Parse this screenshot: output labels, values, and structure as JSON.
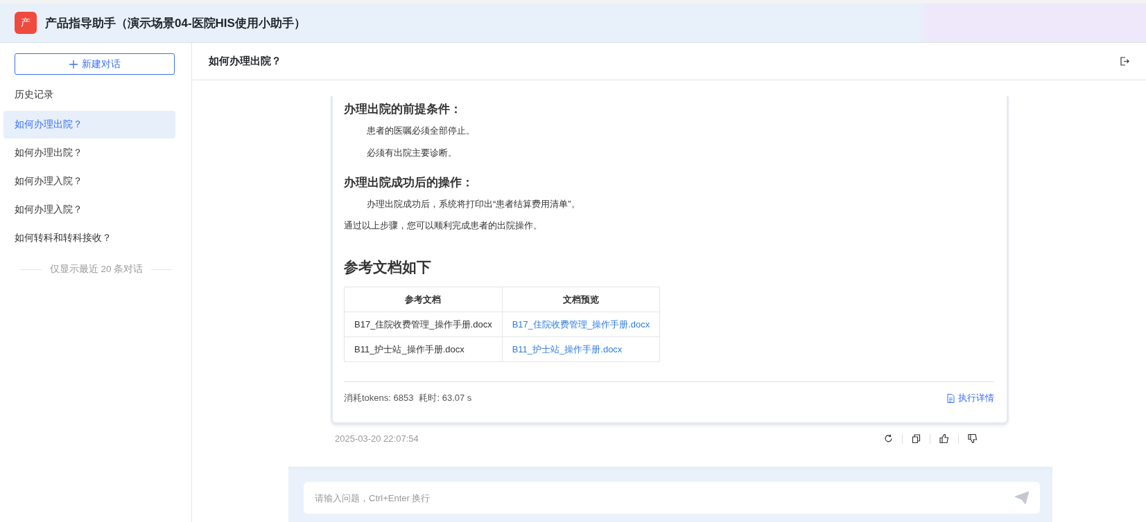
{
  "app": {
    "logo_text": "产",
    "title": "产品指导助手（演示场景04-医院HIS使用小助手）"
  },
  "sidebar": {
    "new_chat_button": "新建对话",
    "history_label": "历史记录",
    "items": [
      {
        "label": "如何办理出院？",
        "selected": true
      },
      {
        "label": "如何办理出院？",
        "selected": false
      },
      {
        "label": "如何办理入院？",
        "selected": false
      },
      {
        "label": "如何办理入院？",
        "selected": false
      },
      {
        "label": "如何转科和转科接收？",
        "selected": false
      }
    ],
    "footer_note": "仅显示最近 20 条对话"
  },
  "conversation": {
    "title": "如何办理出院？",
    "message": {
      "blocks": [
        {
          "kind": "heading",
          "text": "办理出院的前提条件："
        },
        {
          "kind": "indented",
          "text": "患者的医嘱必须全部停止。"
        },
        {
          "kind": "indented",
          "text": "必须有出院主要诊断。"
        },
        {
          "kind": "heading",
          "text": "办理出院成功后的操作："
        },
        {
          "kind": "indented",
          "text": "办理出院成功后，系统将打印出“患者结算费用清单”。"
        },
        {
          "kind": "paragraph",
          "text": "通过以上步骤，您可以顺利完成患者的出院操作。"
        },
        {
          "kind": "section_title",
          "text": "参考文档如下"
        }
      ],
      "table": {
        "columns": [
          "参考文档",
          "文档预览"
        ],
        "rows": [
          [
            "B17_住院收费管理_操作手册.docx",
            "B17_住院收费管理_操作手册.docx"
          ],
          [
            "B11_护士站_操作手册.docx",
            "B11_护士站_操作手册.docx"
          ]
        ]
      },
      "tokens": "消耗tokens: 6853",
      "duration": "耗时: 63.07 s",
      "details_link": "执行详情"
    },
    "timestamp": "2025-03-20 22:07:54"
  },
  "input": {
    "placeholder": "请输入问题，Ctrl+Enter 换行"
  }
}
